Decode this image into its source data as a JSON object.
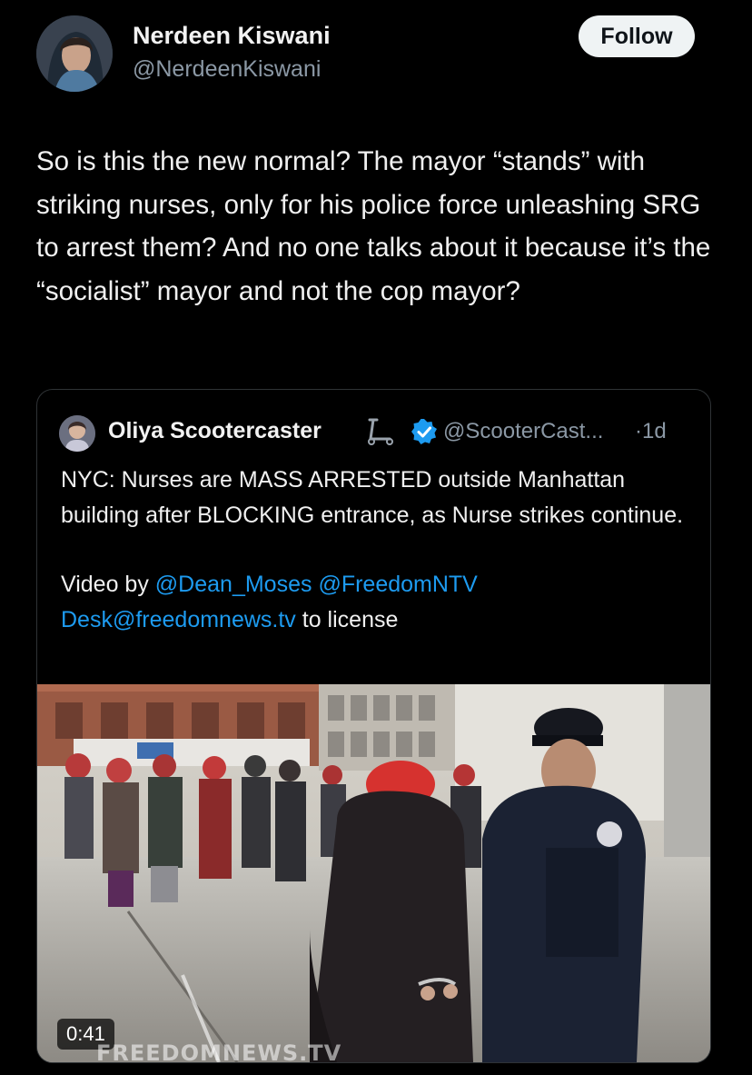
{
  "tweet": {
    "author_name": "Nerdeen Kiswani",
    "author_handle": "@NerdeenKiswani",
    "follow_label": "Follow",
    "text": "So is this the new normal? The mayor “stands” with striking nurses, only for his police force unleashing SRG to arrest them? And no one talks about it because it’s the “socialist” mayor and not the cop mayor?"
  },
  "quote": {
    "author_name": "Oliya Scootercaster",
    "author_handle": "@ScooterCast...",
    "time": "·1d",
    "text": "NYC: Nurses are MASS ARRESTED outside Manhattan building after BLOCKING entrance, as Nurse strikes continue.",
    "video_by_label": "Video by ",
    "mention_1": "@Dean_Moses",
    "mention_2": "@FreedomNTV",
    "email_link": "Desk@freedomnews.tv",
    "license_text": " to license",
    "video_duration": "0:41",
    "video_watermark": "FREEDOMNEWS.TV"
  },
  "colors": {
    "background": "#000000",
    "text": "#f0f0f0",
    "secondary_text": "#8b98a5",
    "link": "#1d9bf0",
    "follow_button": "#eff3f4",
    "verified_badge": "#1d9bf0"
  },
  "icons": [
    "verified-badge-icon",
    "scooter-emoji-icon"
  ]
}
